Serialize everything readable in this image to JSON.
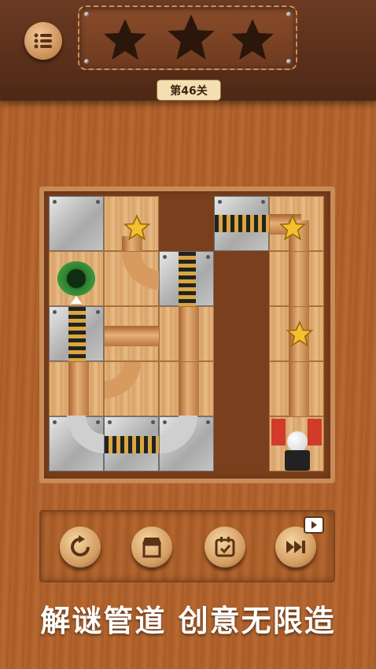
{
  "header": {
    "level_label": "第46关",
    "stars_earned": 0,
    "stars_total": 3,
    "menu_icon": "list-icon"
  },
  "board": {
    "grid_columns": 5,
    "grid_rows": 5,
    "start_piece": "green-hole-start",
    "goal_piece": "white-ball-goal",
    "collectible_stars": 3
  },
  "controls": {
    "buttons": [
      {
        "icon": "restart-icon"
      },
      {
        "icon": "shop-icon"
      },
      {
        "icon": "calendar-check-icon"
      },
      {
        "icon": "skip-level-icon",
        "badge_icon": "video-ad-icon"
      }
    ]
  },
  "tagline": "解谜管道  创意无限造",
  "colors": {
    "header": "#4e2815",
    "wood": "#b3652f",
    "star": "#f4c02c",
    "start_green": "#2f7d2f",
    "flag_red": "#d23a2a"
  }
}
